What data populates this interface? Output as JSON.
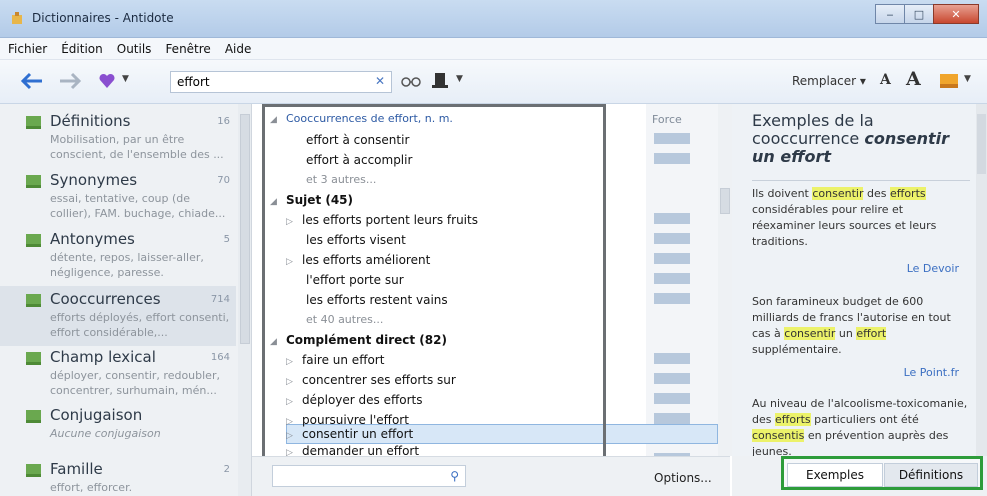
{
  "window": {
    "title": "Dictionnaires - Antidote"
  },
  "menu": [
    {
      "label": "Fichier"
    },
    {
      "label": "Édition"
    },
    {
      "label": "Outils"
    },
    {
      "label": "Fenêtre"
    },
    {
      "label": "Aide"
    }
  ],
  "toolbar": {
    "search_value": "effort",
    "replace_label": "Remplacer",
    "font_small": "A",
    "font_large": "A"
  },
  "sidebar": {
    "items": [
      {
        "title": "Définitions",
        "count": "16",
        "desc": "Mobilisation, par un être conscient, de l'ensemble des ..."
      },
      {
        "title": "Synonymes",
        "count": "70",
        "desc": "essai, tentative, coup (de collier), FAM. buchage, chiade..."
      },
      {
        "title": "Antonymes",
        "count": "5",
        "desc": "détente, repos, laisser-aller, négligence, paresse."
      },
      {
        "title": "Cooccurrences",
        "count": "714",
        "desc": "efforts déployés, effort consenti, effort considérable,..."
      },
      {
        "title": "Champ lexical",
        "count": "164",
        "desc": "déployer, consentir, redoubler, concentrer, surhumain, mén..."
      },
      {
        "title": "Conjugaison",
        "count": "",
        "desc": "Aucune conjugaison"
      },
      {
        "title": "Famille",
        "count": "2",
        "desc": "effort, efforcer."
      }
    ]
  },
  "list": {
    "header": "Cooccurrences de effort, n. m.",
    "force_label": "Force",
    "rows": [
      {
        "text": "effort à consentir"
      },
      {
        "text": "effort à accomplir"
      },
      {
        "text": "et 3 autres..."
      },
      {
        "text": "Sujet (45)"
      },
      {
        "text": "les efforts portent leurs fruits"
      },
      {
        "text": "les efforts visent"
      },
      {
        "text": "les efforts améliorent"
      },
      {
        "text": "l'effort porte sur"
      },
      {
        "text": "les efforts restent vains"
      },
      {
        "text": "et 40 autres..."
      },
      {
        "text": "Complément direct (82)"
      },
      {
        "text": "faire un effort"
      },
      {
        "text": "concentrer ses efforts sur"
      },
      {
        "text": "déployer des efforts"
      },
      {
        "text": "poursuivre l'effort"
      },
      {
        "text": "consentir un effort"
      },
      {
        "text": "demander un effort"
      }
    ],
    "options_label": "Options..."
  },
  "detail": {
    "title_prefix": "Exemples de la cooccurrence",
    "title_highlight": "consentir un effort",
    "examples": [
      {
        "p1": "Ils doivent ",
        "m1": "consentir",
        "p2": " des ",
        "m2": "efforts",
        "p3": " considérables pour relire et réexaminer leurs sources et leurs traditions.",
        "source": "Le Devoir"
      },
      {
        "p1": "Son faramineux budget de 600 milliards de francs l'autorise en tout cas à ",
        "m1": "consentir",
        "p2": " un ",
        "m2": "effort",
        "p3": " supplémentaire.",
        "source": "Le Point.fr"
      },
      {
        "p1": "Au niveau de l'alcoolisme-toxicomanie, des ",
        "m1": "efforts",
        "p2": " particuliers ont été ",
        "m2": "consentis",
        "p3": " en prévention auprès des jeunes.",
        "source": ""
      }
    ]
  },
  "tabs": [
    {
      "label": "Exemples"
    },
    {
      "label": "Définitions"
    }
  ],
  "colors": {
    "accent_blue": "#3b6fc2",
    "highlight": "#ecf26a",
    "frame_green": "#2d9c3a",
    "icon_green": "#6aa84f"
  }
}
